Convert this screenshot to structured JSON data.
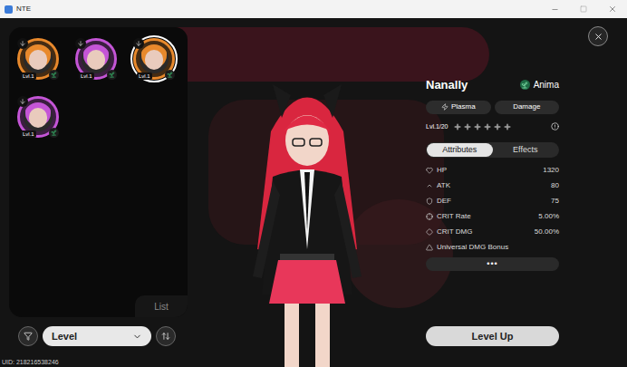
{
  "window": {
    "title": "NTE"
  },
  "roster": {
    "characters": [
      {
        "level": "Lvl.1",
        "selected": false,
        "color": "#e8892c"
      },
      {
        "level": "Lvl.1",
        "selected": false,
        "color": "#c455d6"
      },
      {
        "level": "Lvl.1",
        "selected": true,
        "color": "#e8892c"
      },
      {
        "level": "Lvl.1",
        "selected": false,
        "color": "#c455d6"
      }
    ],
    "tab": "List"
  },
  "sort": {
    "label": "Level"
  },
  "uid": "UID: 218216538246",
  "character": {
    "name": "Nanally",
    "attribute": "Anima",
    "tags": [
      "Plasma",
      "Damage"
    ],
    "level": "Lvl.1/20",
    "stars": 0
  },
  "tabs": [
    {
      "label": "Attributes",
      "selected": true
    },
    {
      "label": "Effects",
      "selected": false
    }
  ],
  "stats": [
    {
      "label": "HP",
      "value": "1320"
    },
    {
      "label": "ATK",
      "value": "80"
    },
    {
      "label": "DEF",
      "value": "75"
    },
    {
      "label": "CRIT Rate",
      "value": "5.00%"
    },
    {
      "label": "CRIT DMG",
      "value": "50.00%"
    },
    {
      "label": "Universal DMG Bonus"
    }
  ],
  "more": "•••",
  "level_up": "Level Up"
}
